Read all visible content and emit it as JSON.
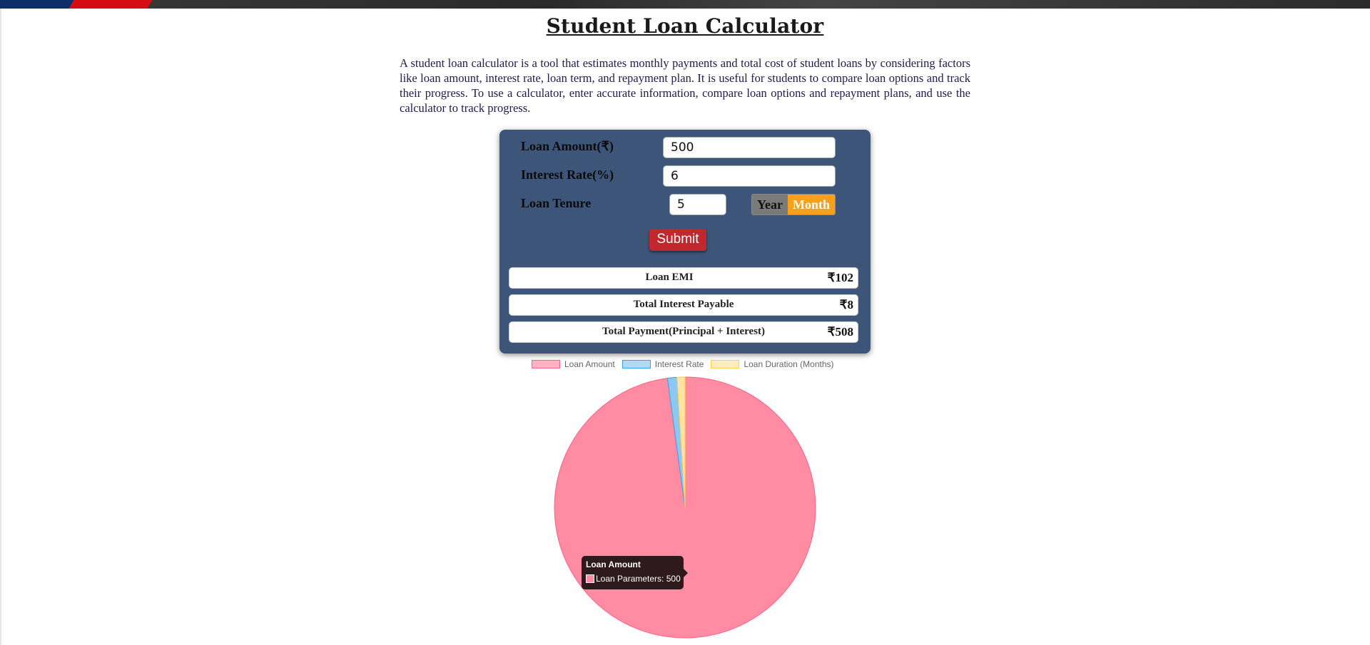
{
  "page": {
    "title": "Student Loan Calculator",
    "description": "A student loan calculator is a tool that estimates monthly payments and total cost of student loans by considering factors like loan amount, interest rate, loan term, and repayment plan. It is useful for students to compare loan options and track their progress. To use a calculator, enter accurate information, compare loan options and repayment plans, and use the calculator to track progress."
  },
  "form": {
    "loan_amount_label": "Loan Amount(₹)",
    "loan_amount_value": "500",
    "interest_rate_label": "Interest Rate(%)",
    "interest_rate_value": "6",
    "loan_tenure_label": "Loan Tenure",
    "loan_tenure_value": "5",
    "year_label": "Year",
    "month_label": "Month",
    "selected_unit": "Month",
    "submit_label": "Submit"
  },
  "results": [
    {
      "label": "Loan EMI",
      "value": "₹102"
    },
    {
      "label": "Total Interest Payable",
      "value": "₹8"
    },
    {
      "label": "Total Payment(Principal + Interest)",
      "value": "₹508"
    }
  ],
  "colors": {
    "card_bg": "#3d5579",
    "accent_month": "#f7a01a",
    "submit_bg": "#c1272d",
    "slice_loan": "#ff8ca3",
    "slice_interest": "#8cc8f0",
    "slice_duration": "#ffe3a0"
  },
  "chart_data": {
    "type": "pie",
    "categories": [
      "Loan Amount",
      "Interest Rate",
      "Loan Duration (Months)"
    ],
    "series": [
      {
        "name": "Loan Parameters",
        "values": [
          500,
          6,
          5
        ]
      }
    ],
    "legend_position": "top",
    "tooltip": {
      "title": "Loan Amount",
      "series": "Loan Parameters",
      "value": 500
    }
  }
}
